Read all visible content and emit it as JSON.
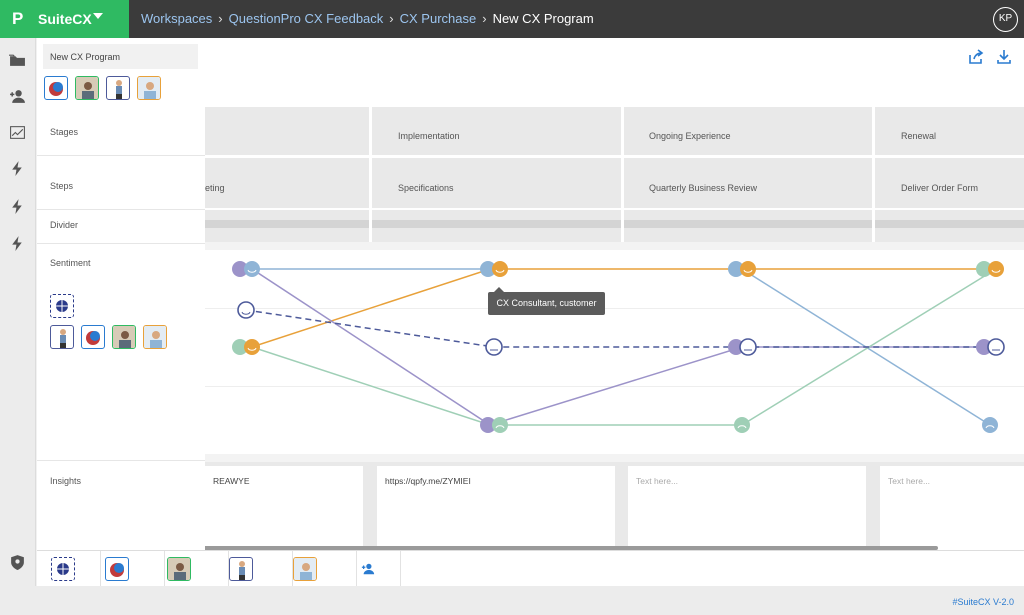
{
  "brand": {
    "name": "SuiteCX",
    "logo_letter": "P"
  },
  "breadcrumb": [
    "Workspaces",
    "QuestionPro CX Feedback",
    "CX Purchase",
    "New CX Program"
  ],
  "user": {
    "initials": "KP"
  },
  "program": {
    "title": "New CX Program"
  },
  "rows": {
    "stages": "Stages",
    "steps": "Steps",
    "divider": "Divider",
    "sentiment": "Sentiment",
    "insights": "Insights"
  },
  "stages": [
    "",
    "Implementation",
    "Ongoing Experience",
    "Renewal"
  ],
  "steps": [
    "eting",
    "Specifications",
    "Quarterly Business Review",
    "Deliver Order Form"
  ],
  "insights": [
    "REAWYE",
    "https://qpfy.me/ZYMIEI",
    "Text here...",
    "Text here..."
  ],
  "tooltip": "CX Consultant, customer",
  "version": "#SuiteCX V-2.0",
  "colors": {
    "orange": "#e8a13a",
    "blue": "#8fb4d6",
    "purple": "#9c93c9",
    "green": "#9fcfb6",
    "navy": "#4d5a9a",
    "accent": "#2fba62"
  },
  "icons": [
    "folder-icon",
    "add-user-icon",
    "chart-icon",
    "bolt-icon",
    "shield-icon",
    "gear-icon",
    "share-icon",
    "download-icon",
    "globe-icon"
  ]
}
